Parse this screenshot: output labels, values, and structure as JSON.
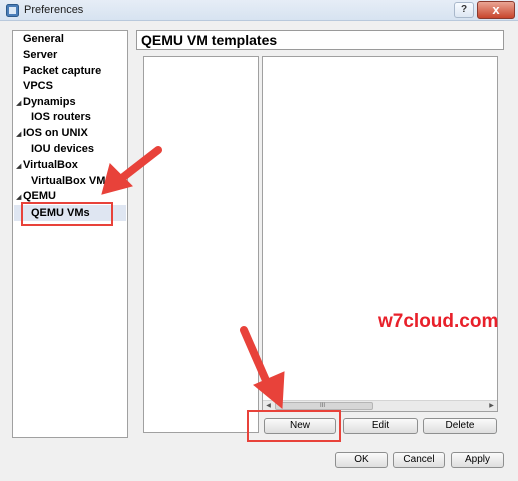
{
  "window": {
    "title": "Preferences",
    "help_label": "?",
    "close_label": "x"
  },
  "sidebar": {
    "items": [
      {
        "label": "General"
      },
      {
        "label": "Server"
      },
      {
        "label": "Packet capture"
      },
      {
        "label": "VPCS"
      },
      {
        "label": "Dynamips"
      },
      {
        "label": "IOS routers"
      },
      {
        "label": "IOS on UNIX"
      },
      {
        "label": "IOU devices"
      },
      {
        "label": "VirtualBox"
      },
      {
        "label": "VirtualBox VMs"
      },
      {
        "label": "QEMU"
      },
      {
        "label": "QEMU VMs"
      }
    ],
    "selected": "QEMU VMs"
  },
  "main": {
    "title": "QEMU VM templates",
    "scrollbar_grip": "III",
    "buttons": {
      "new": "New",
      "edit": "Edit",
      "delete": "Delete"
    }
  },
  "footer": {
    "ok": "OK",
    "cancel": "Cancel",
    "apply": "Apply"
  },
  "watermark": "w7cloud.com",
  "colors": {
    "annotation": "#e8423a",
    "watermark": "#e8202a",
    "selection": "#dfe6f2"
  }
}
